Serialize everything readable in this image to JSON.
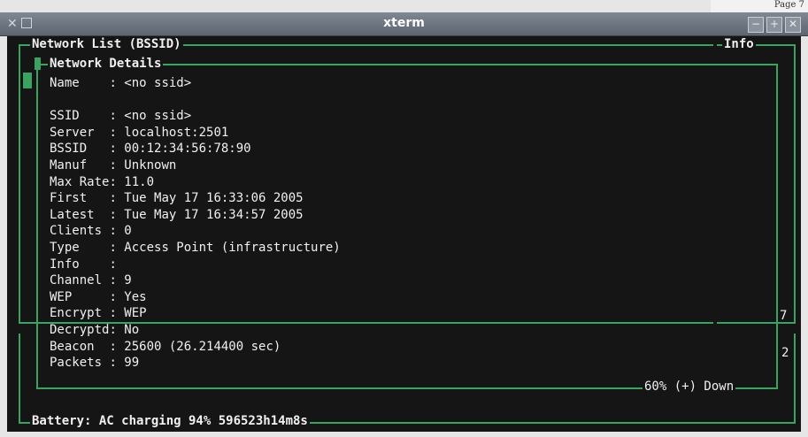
{
  "page_edge": "Page 7",
  "window": {
    "title": "xterm",
    "left_icons": "✕",
    "buttons": [
      "−",
      "+",
      "✕"
    ]
  },
  "panels": {
    "network_list": "Network List (BSSID)",
    "info": "Info",
    "details_title": "Network Details",
    "battery": "Battery: AC charging 94% 596523h14m8s",
    "scroll_status": "60% (+) Down",
    "side_numbers": [
      "7",
      "2"
    ]
  },
  "details": [
    {
      "key": "Name    ",
      "value": "<no ssid>"
    },
    {
      "key": "",
      "value": ""
    },
    {
      "key": "SSID    ",
      "value": "<no ssid>"
    },
    {
      "key": "Server  ",
      "value": "localhost:2501"
    },
    {
      "key": "BSSID   ",
      "value": "00:12:34:56:78:90"
    },
    {
      "key": "Manuf   ",
      "value": "Unknown"
    },
    {
      "key": "Max Rate",
      "value": "11.0"
    },
    {
      "key": "First   ",
      "value": "Tue May 17 16:33:06 2005"
    },
    {
      "key": "Latest  ",
      "value": "Tue May 17 16:34:57 2005"
    },
    {
      "key": "Clients ",
      "value": "0"
    },
    {
      "key": "Type    ",
      "value": "Access Point (infrastructure)"
    },
    {
      "key": "Info    ",
      "value": ""
    },
    {
      "key": "Channel ",
      "value": "9"
    },
    {
      "key": "WEP     ",
      "value": "Yes"
    },
    {
      "key": "Encrypt ",
      "value": "WEP"
    },
    {
      "key": "Decryptd",
      "value": "No"
    },
    {
      "key": "Beacon  ",
      "value": "25600 (26.214400 sec)"
    },
    {
      "key": "Packets ",
      "value": "99"
    }
  ]
}
